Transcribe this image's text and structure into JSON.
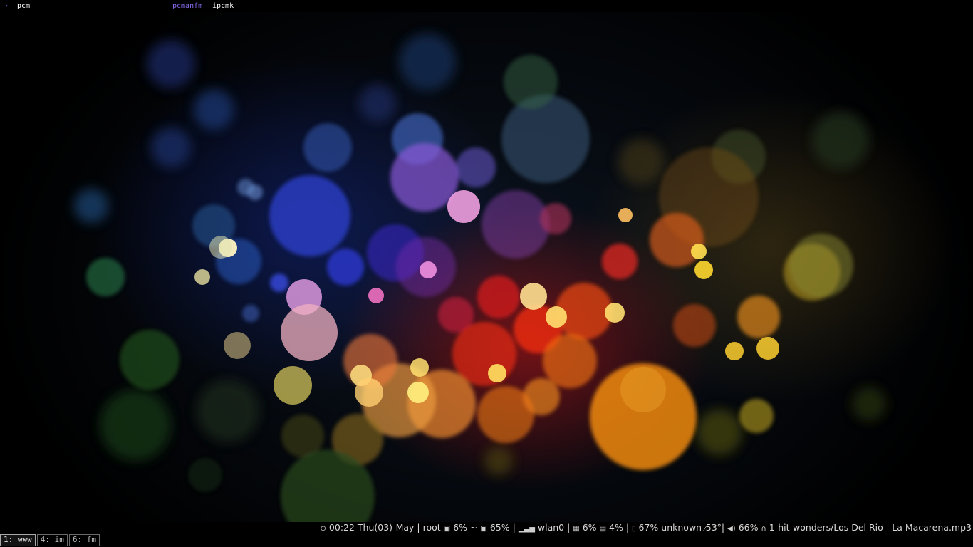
{
  "launcher": {
    "prompt_glyph": "›",
    "query": "pcm",
    "matches": [
      {
        "label": "pcmanfm",
        "selected": true
      },
      {
        "label": "ipcmk",
        "selected": false
      }
    ]
  },
  "wallpaper": {
    "name": "bokeh",
    "accent_colors": [
      "#2a3fbf",
      "#e62a2a",
      "#f29a1e",
      "#f4c84a",
      "#d64fd6",
      "#3a7a3a"
    ]
  },
  "statusbar": {
    "clock_icon": "clock-icon",
    "time": "00:22 Thu(03)-May",
    "user": "root",
    "disk_root_icon": "disk-icon",
    "disk_root": "6%",
    "home_sep": "~",
    "disk_home_icon": "disk-icon",
    "disk_home": "65%",
    "network_icon": "signal-icon",
    "network": "wlan0",
    "cpu_icon": "cpu-icon",
    "cpu": "6%",
    "mem_icon": "memory-icon",
    "mem": "4%",
    "battery_icon": "battery-icon",
    "battery": "67% unknown",
    "temp_icon": "thermometer-icon",
    "temp": "53°",
    "volume_icon": "speaker-icon",
    "volume": "66%",
    "music_icon": "headphones-icon",
    "track": "1-hit-wonders/Los Del Rio - La Macarena.mp3",
    "separator": "|"
  },
  "workspaces": [
    {
      "label": "1: www",
      "active": true
    },
    {
      "label": "4: im",
      "active": false
    },
    {
      "label": "6: fm",
      "active": false
    }
  ]
}
